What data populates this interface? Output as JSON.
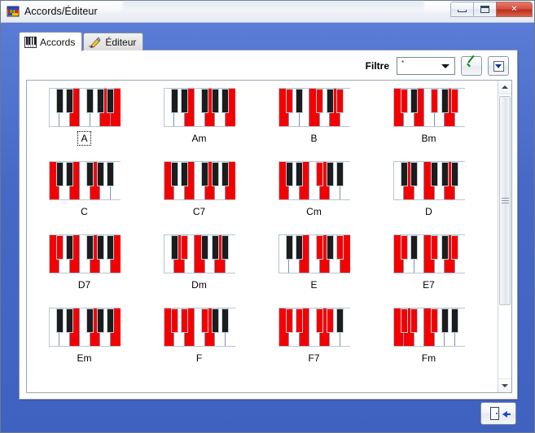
{
  "window": {
    "title": "Accords/Éditeur",
    "icon": "app-icon",
    "controls": {
      "minimize": "minimize-button",
      "maximize": "maximize-button",
      "close": "×"
    }
  },
  "tabs": [
    {
      "label": "Accords",
      "icon": "piano-icon",
      "active": true
    },
    {
      "label": "Éditeur",
      "icon": "pencil-icon",
      "active": false
    }
  ],
  "toolbar": {
    "filter_label": "Filtre",
    "filter_value": "*",
    "filter_placeholder": "*",
    "apply_label": "apply-filter",
    "dropdown_label": "more-options"
  },
  "footer": {
    "exit_label": "exit-button"
  },
  "scrollbar": {
    "up_label": "scroll-up",
    "down_label": "scroll-down",
    "thumb_label": "scroll-thumb"
  },
  "chord_grid": {
    "columns": 4,
    "rows": 4,
    "focused": "A",
    "white_keys": 7,
    "black_key_positions": [
      0,
      1,
      3,
      4,
      5
    ],
    "items": [
      {
        "name": "A",
        "white_on": [
          2,
          5,
          6
        ],
        "black_on": []
      },
      {
        "name": "Am",
        "white_on": [
          2,
          4,
          6
        ],
        "black_on": []
      },
      {
        "name": "B",
        "white_on": [
          0,
          3,
          5
        ],
        "black_on": [
          0,
          3,
          5
        ]
      },
      {
        "name": "Bm",
        "white_on": [
          0,
          2,
          5
        ],
        "black_on": [
          0,
          3,
          5
        ]
      },
      {
        "name": "C",
        "white_on": [
          0,
          2,
          4
        ],
        "black_on": []
      },
      {
        "name": "C7",
        "white_on": [
          0,
          2,
          4,
          6
        ],
        "black_on": []
      },
      {
        "name": "Cm",
        "white_on": [
          0,
          2,
          4
        ],
        "black_on": [
          3
        ]
      },
      {
        "name": "D",
        "white_on": [
          1,
          3,
          5
        ],
        "black_on": []
      },
      {
        "name": "D7",
        "white_on": [
          0,
          2,
          4,
          6
        ],
        "black_on": [
          0
        ]
      },
      {
        "name": "Dm",
        "white_on": [
          1,
          3,
          5
        ],
        "black_on": [
          1
        ]
      },
      {
        "name": "E",
        "white_on": [
          2,
          4,
          6
        ],
        "black_on": [
          3,
          5
        ]
      },
      {
        "name": "E7",
        "white_on": [
          0,
          3,
          5
        ],
        "black_on": [
          0,
          3,
          5
        ]
      },
      {
        "name": "Em",
        "white_on": [
          2,
          4,
          6
        ],
        "black_on": []
      },
      {
        "name": "F",
        "white_on": [
          0,
          2,
          4
        ],
        "black_on": [
          0,
          1,
          3
        ]
      },
      {
        "name": "F7",
        "white_on": [
          0,
          2,
          4
        ],
        "black_on": [
          0,
          1,
          3,
          4
        ]
      },
      {
        "name": "Fm",
        "white_on": [
          0,
          1,
          3
        ],
        "black_on": [
          0,
          1,
          3
        ]
      }
    ]
  }
}
